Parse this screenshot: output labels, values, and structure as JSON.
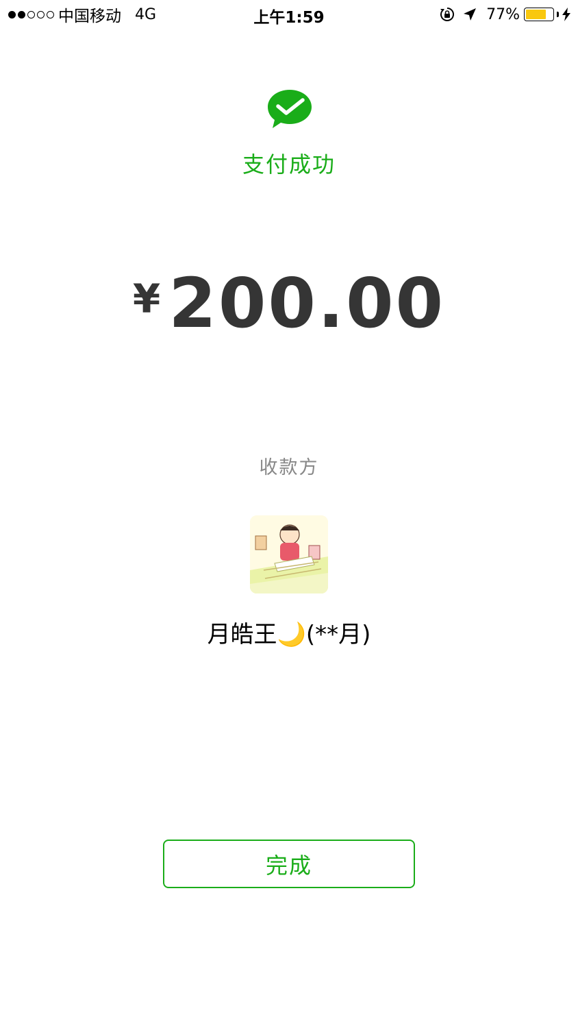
{
  "status_bar": {
    "carrier": "中国移动",
    "network": "4G",
    "time": "上午1:59",
    "battery_percent": "77%",
    "battery_level": 0.77,
    "signal_strength": 2,
    "signal_max": 5,
    "icons": [
      "rotation-lock-icon",
      "location-arrow-icon",
      "battery-icon",
      "charging-bolt-icon"
    ]
  },
  "payment": {
    "status_title": "支付成功",
    "currency_symbol": "¥",
    "amount": "200.00",
    "payee_label": "收款方",
    "payee_name": "月皓王🌙(**月)"
  },
  "actions": {
    "done_label": "完成"
  },
  "colors": {
    "brand_green": "#1aad19",
    "amount_text": "#353535",
    "label_gray": "#888888",
    "battery_yellow": "#f9c80e"
  }
}
